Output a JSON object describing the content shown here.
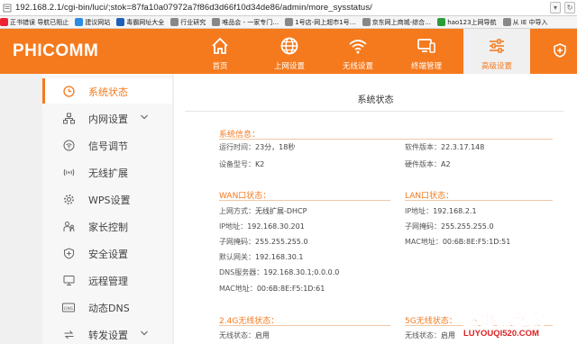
{
  "browser": {
    "url": "192.168.2.1/cgi-bin/luci/;stok=87fa10a07972a7f86d3d66f10d34de86/admin/more_sysstatus/",
    "bookmarks": [
      {
        "label": "正书错误 导航已阻止",
        "color": "#e23"
      },
      {
        "label": "建议网站",
        "color": "#2a8be0"
      },
      {
        "label": "毒霸网址大全",
        "color": "#1e5fb8"
      },
      {
        "label": "行业研究",
        "color": "#888"
      },
      {
        "label": "唯品会 - 一家专门…",
        "color": "#888"
      },
      {
        "label": "1号店-网上超市1号…",
        "color": "#888"
      },
      {
        "label": "京东网上商城-综合…",
        "color": "#888"
      },
      {
        "label": "hao123上网导航",
        "color": "#2a9d3a"
      },
      {
        "label": "从 IE 中导入",
        "color": "#888"
      }
    ]
  },
  "header": {
    "logo": "PHICOMM",
    "nav": [
      {
        "label": "首页",
        "icon": "home-icon"
      },
      {
        "label": "上网设置",
        "icon": "globe-icon"
      },
      {
        "label": "无线设置",
        "icon": "wifi-icon"
      },
      {
        "label": "终端管理",
        "icon": "devices-icon"
      },
      {
        "label": "高级设置",
        "icon": "sliders-icon",
        "active": true
      }
    ],
    "accent": "#f57a1e"
  },
  "sidebar": {
    "items": [
      {
        "label": "系统状态",
        "icon": "clock-icon",
        "active": true
      },
      {
        "label": "内网设置",
        "icon": "network-icon",
        "has_chevron": true
      },
      {
        "label": "信号调节",
        "icon": "signal-icon"
      },
      {
        "label": "无线扩展",
        "icon": "extend-icon"
      },
      {
        "label": "WPS设置",
        "icon": "gear-icon"
      },
      {
        "label": "家长控制",
        "icon": "parental-icon"
      },
      {
        "label": "安全设置",
        "icon": "shield-icon"
      },
      {
        "label": "远程管理",
        "icon": "remote-icon"
      },
      {
        "label": "动态DNS",
        "icon": "dns-icon"
      },
      {
        "label": "转发设置",
        "icon": "forward-icon",
        "has_chevron": true
      }
    ]
  },
  "main": {
    "title": "系统状态",
    "system": {
      "title": "系统信息：",
      "uptime_label": "运行时间：",
      "uptime_value": "23分，18秒",
      "model_label": "设备型号：",
      "model_value": "K2",
      "sw_label": "软件版本：",
      "sw_value": "22.3.17.148",
      "hw_label": "硬件版本：",
      "hw_value": "A2"
    },
    "wan": {
      "title": "WAN口状态：",
      "mode_label": "上网方式：",
      "mode_value": "无线扩展-DHCP",
      "ip_label": "IP地址：",
      "ip_value": "192.168.30.201",
      "mask_label": "子网掩码：",
      "mask_value": "255.255.255.0",
      "gw_label": "默认网关：",
      "gw_value": "192.168.30.1",
      "dns_label": "DNS服务器：",
      "dns_value": "192.168.30.1;0.0.0.0",
      "mac_label": "MAC地址：",
      "mac_value": "00:6B:8E:F5:1D:61"
    },
    "lan": {
      "title": "LAN口状态：",
      "ip_label": "IP地址：",
      "ip_value": "192.168.2.1",
      "mask_label": "子网掩码：",
      "mask_value": "255.255.255.0",
      "mac_label": "MAC地址：",
      "mac_value": "00:6B:8E:F5:1D:51"
    },
    "wl24": {
      "title": "2.4G无线状态：",
      "status_label": "无线状态：",
      "status_value": "启用"
    },
    "wl5": {
      "title": "5G无线状态：",
      "status_label": "无线状态：",
      "status_value": "启用"
    }
  },
  "watermark": {
    "big": "路由器之家",
    "small": "LUYOUQI520.COM"
  }
}
